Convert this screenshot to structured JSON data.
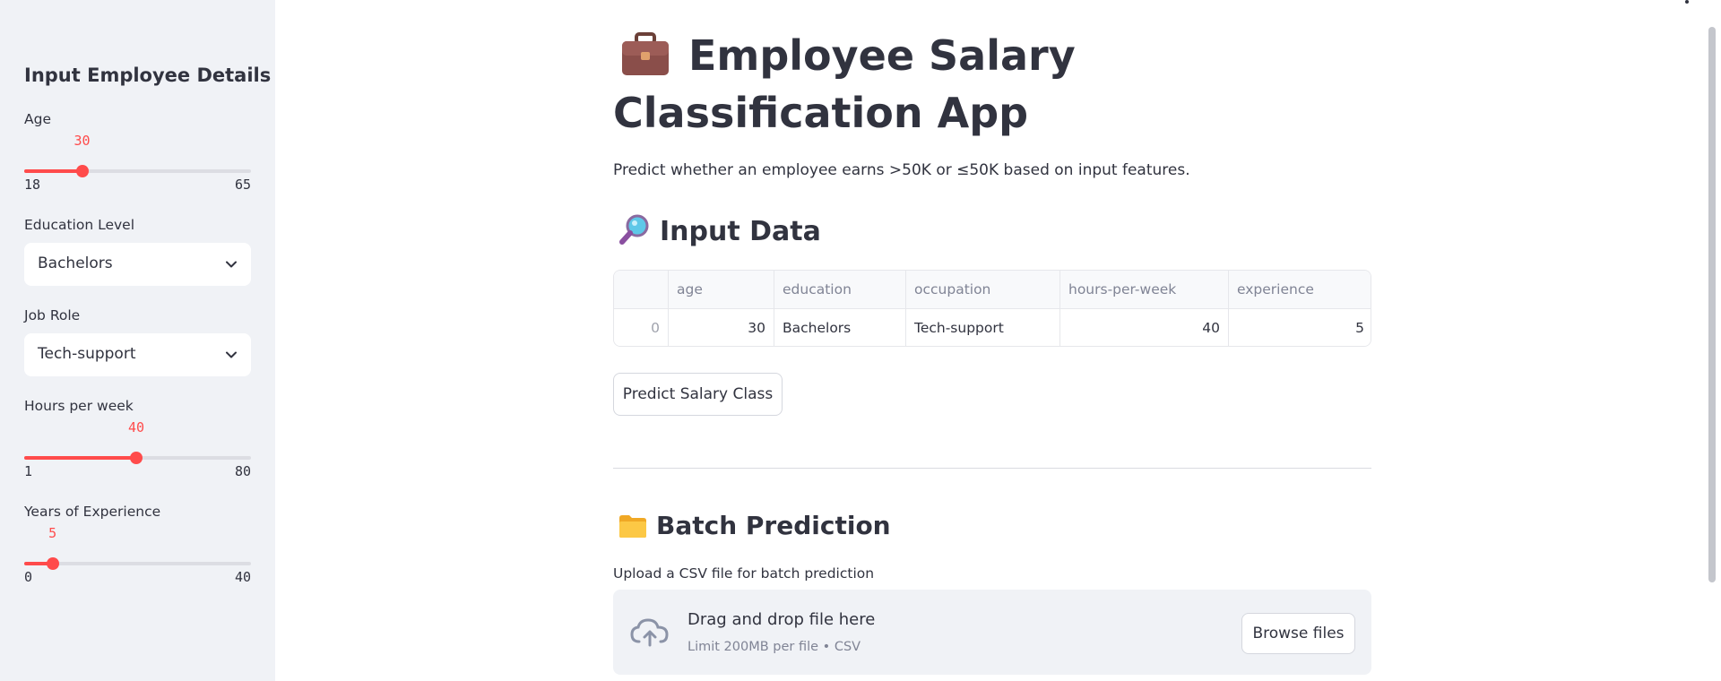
{
  "sidebar": {
    "title": "Input Employee Details",
    "age": {
      "label": "Age",
      "value": "30",
      "min": "18",
      "max": "65",
      "fraction": 0.255
    },
    "education": {
      "label": "Education Level",
      "value": "Bachelors"
    },
    "job_role": {
      "label": "Job Role",
      "value": "Tech-support"
    },
    "hours": {
      "label": "Hours per week",
      "value": "40",
      "min": "1",
      "max": "80",
      "fraction": 0.494
    },
    "experience": {
      "label": "Years of Experience",
      "value": "5",
      "min": "0",
      "max": "40",
      "fraction": 0.125
    }
  },
  "main": {
    "title": "Employee Salary Classification App",
    "description": "Predict whether an employee earns >50K or ≤50K based on input features.",
    "input_data_heading": "Input Data",
    "table": {
      "columns": [
        "",
        "age",
        "education",
        "occupation",
        "hours-per-week",
        "experience"
      ],
      "rows": [
        [
          "0",
          "30",
          "Bachelors",
          "Tech-support",
          "40",
          "5"
        ]
      ]
    },
    "predict_button": "Predict Salary Class",
    "batch_heading": "Batch Prediction",
    "upload_label": "Upload a CSV file for batch prediction",
    "dropzone": {
      "title": "Drag and drop file here",
      "subtitle": "Limit 200MB per file • CSV",
      "browse_button": "Browse files"
    }
  },
  "icons": {
    "title_icon": "briefcase-icon",
    "input_data_icon": "magnifier-icon",
    "batch_icon": "folder-icon",
    "upload_icon": "cloud-upload-icon",
    "dropdown_icon": "chevron-down-icon"
  },
  "colors": {
    "accent": "#ff4b4b",
    "sidebar_bg": "#f0f2f6",
    "text": "#31333f"
  }
}
